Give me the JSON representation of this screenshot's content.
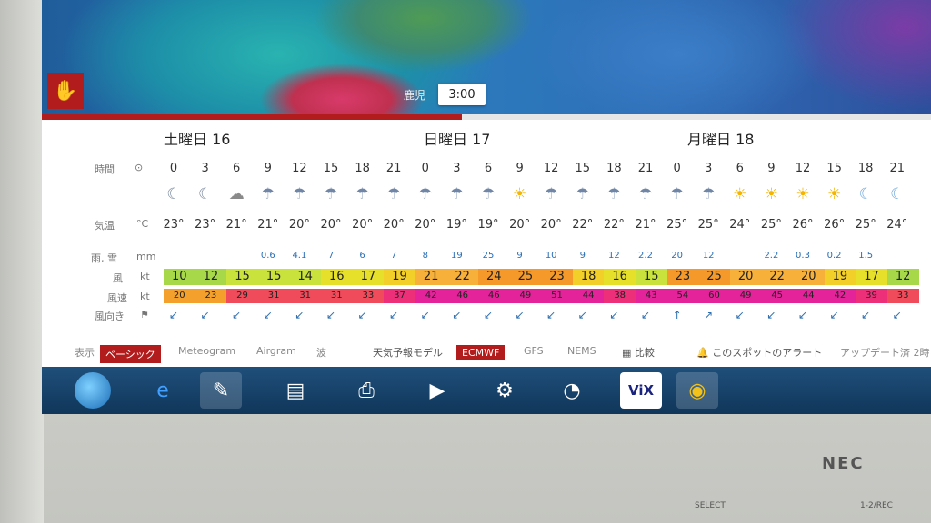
{
  "map": {
    "city_label": "鹿児",
    "time_bubble": "3:00",
    "accent": "#b31c1c"
  },
  "days": [
    "土曜日 16",
    "日曜日 17",
    "月曜日 18"
  ],
  "labels": {
    "time": "時間",
    "temp": "気温",
    "temp_unit": "°C",
    "precip": "雨, 雪",
    "precip_unit": "mm",
    "wind": "風",
    "wind_unit": "kt",
    "gust": "風速",
    "gust_unit": "kt",
    "dir": "風向き"
  },
  "hours": [
    "0",
    "3",
    "6",
    "9",
    "12",
    "15",
    "18",
    "21",
    "0",
    "3",
    "6",
    "9",
    "12",
    "15",
    "18",
    "21",
    "0",
    "3",
    "6",
    "9",
    "12",
    "15",
    "18",
    "21"
  ],
  "icons": [
    "moon-cloud",
    "moon-cloud",
    "cloud",
    "rain",
    "rain",
    "rain",
    "rain",
    "rain",
    "rain",
    "rain",
    "rain",
    "sun-rain",
    "rain",
    "rain",
    "rain",
    "rain",
    "rain",
    "rain",
    "sun",
    "sun",
    "sun",
    "sun",
    "moon",
    "moon"
  ],
  "temps": [
    "23°",
    "23°",
    "21°",
    "21°",
    "20°",
    "20°",
    "20°",
    "20°",
    "20°",
    "19°",
    "19°",
    "20°",
    "20°",
    "22°",
    "22°",
    "21°",
    "25°",
    "25°",
    "24°",
    "25°",
    "26°",
    "26°",
    "25°",
    "24°"
  ],
  "precip": [
    "",
    "",
    "",
    "0.6",
    "4.1",
    "7",
    "6",
    "7",
    "8",
    "19",
    "25",
    "9",
    "10",
    "9",
    "12",
    "2.2",
    "20",
    "12",
    "",
    "2.2",
    "0.3",
    "0.2",
    "1.5",
    ""
  ],
  "wind": [
    "10",
    "12",
    "15",
    "15",
    "14",
    "16",
    "17",
    "19",
    "21",
    "22",
    "24",
    "25",
    "23",
    "18",
    "16",
    "15",
    "23",
    "25",
    "20",
    "22",
    "20",
    "19",
    "17",
    "12"
  ],
  "gust": [
    "20",
    "23",
    "29",
    "31",
    "31",
    "31",
    "33",
    "37",
    "42",
    "46",
    "46",
    "49",
    "51",
    "44",
    "38",
    "43",
    "54",
    "60",
    "49",
    "45",
    "44",
    "42",
    "39",
    "33"
  ],
  "dir_arrows": [
    "↙",
    "↙",
    "↙",
    "↙",
    "↙",
    "↙",
    "↙",
    "↙",
    "↙",
    "↙",
    "↙",
    "↙",
    "↙",
    "↙",
    "↙",
    "↙",
    "↑",
    "↗",
    "↙",
    "↙",
    "↙",
    "↙",
    "↙",
    "↙"
  ],
  "bottom": {
    "display": "表示",
    "basic": "ベーシック",
    "meteogram": "Meteogram",
    "airgram": "Airgram",
    "wave": "波",
    "model": "天気予報モデル",
    "ecmwf": "ECMWF",
    "gfs": "GFS",
    "nems": "NEMS",
    "compare": "比較",
    "alert": "このスポットのアラート",
    "update": "アップデート済 2時"
  },
  "monitor": {
    "brand": "NEC",
    "select": "SELECT",
    "rpt": "1-2/REC"
  }
}
